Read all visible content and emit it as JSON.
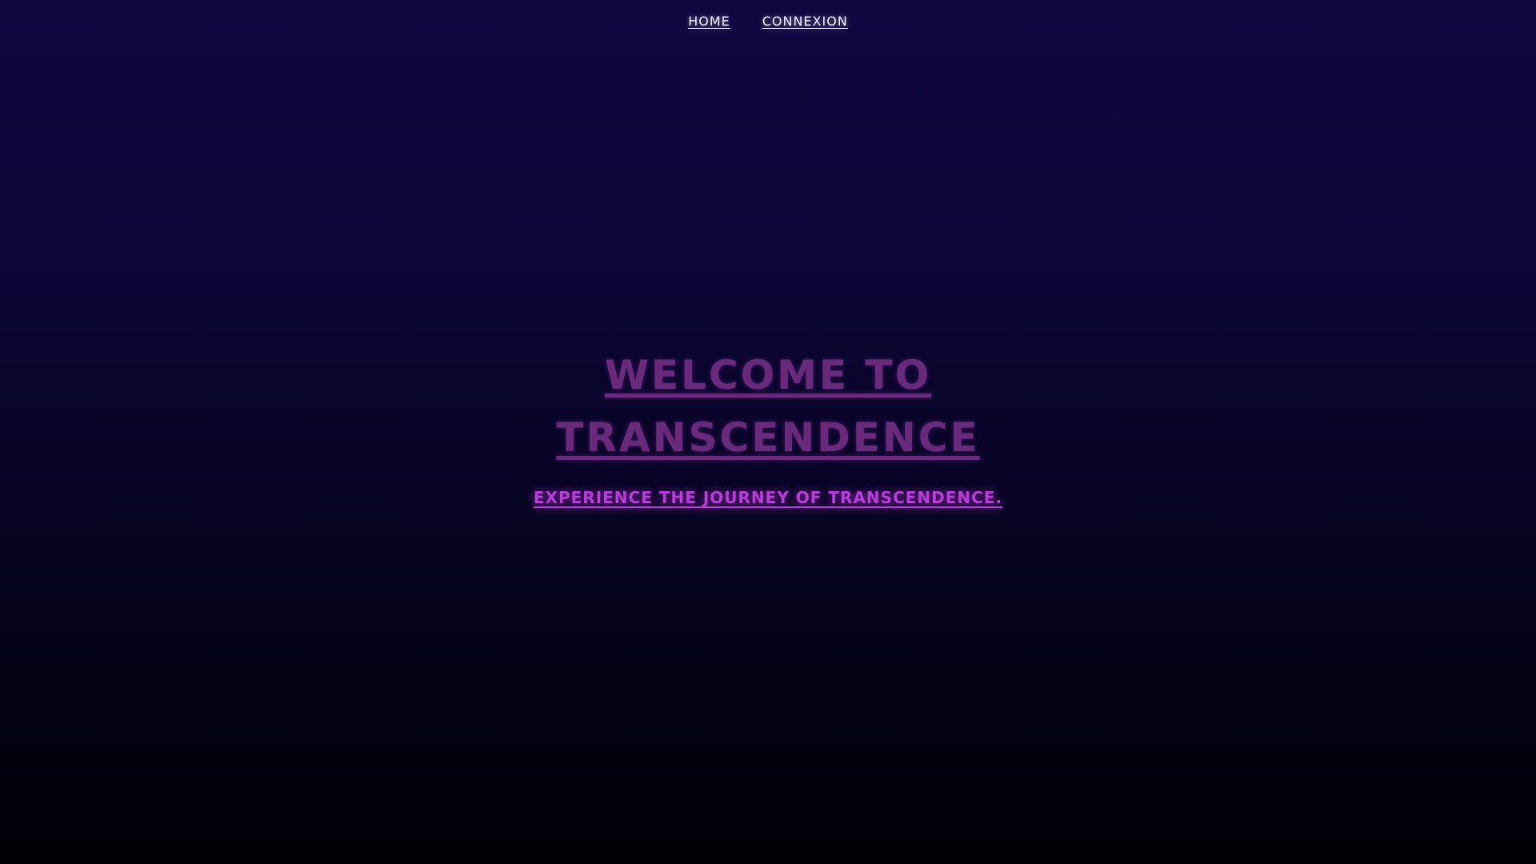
{
  "nav": {
    "items": [
      {
        "label": "Home"
      },
      {
        "label": "Connexion"
      }
    ]
  },
  "hero": {
    "title": "Welcome to Transcendence",
    "subtitle": "Experience the journey of transcendence."
  },
  "colors": {
    "background_top": "#0f0740",
    "background_bottom": "#010006",
    "nav_text": "#e8e4f4",
    "title": "#6a2a7c",
    "subtitle": "#b33dd6"
  }
}
